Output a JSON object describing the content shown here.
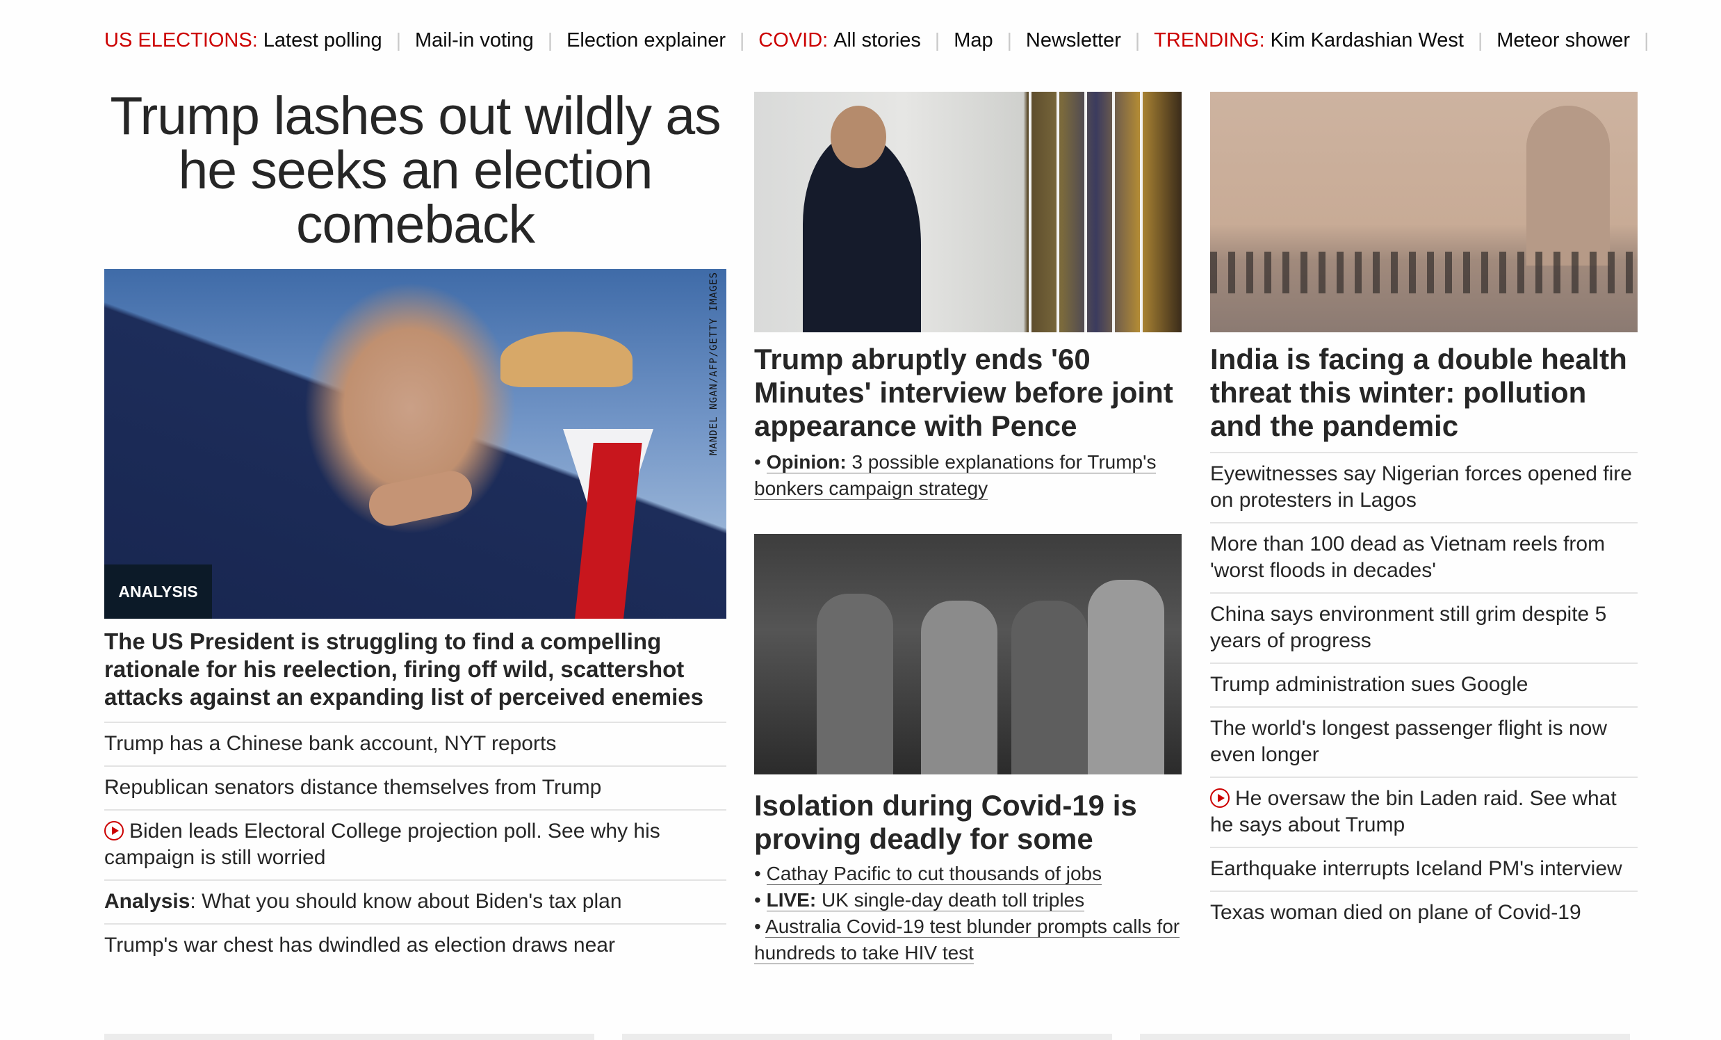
{
  "topnav": [
    {
      "category": "US ELECTIONS:",
      "links": [
        "Latest polling",
        "Mail-in voting",
        "Election explainer"
      ]
    },
    {
      "category": "COVID:",
      "links": [
        "All stories",
        "Map",
        "Newsletter"
      ]
    },
    {
      "category": "TRENDING:",
      "links": [
        "Kim Kardashian West",
        "Meteor shower"
      ]
    }
  ],
  "colors": {
    "accent": "#cc0000",
    "text": "#262626",
    "badge_bg": "#0c1a28"
  },
  "lead": {
    "title": "Trump lashes out wildly as he seeks an election comeback",
    "image_credit": "MANDEL NGAN/AFP/GETTY IMAGES",
    "badge": "ANALYSIS",
    "dek": "The US President is struggling to find a compelling rationale for his reelection, firing off wild, scattershot attacks against an expanding list of perceived enemies",
    "items": [
      {
        "text": "Trump has a Chinese bank account, NYT reports"
      },
      {
        "text": "Republican senators distance themselves from Trump"
      },
      {
        "text": "Biden leads Electoral College projection poll. See why his campaign is still worried",
        "icon": "play-icon"
      },
      {
        "prefix": "Analysis",
        "text": ": What you should know about Biden's tax plan"
      },
      {
        "text": "Trump's war chest has dwindled as election draws near"
      }
    ]
  },
  "trump_story": {
    "title": "Trump abruptly ends '60 Minutes' interview before joint appearance with Pence",
    "bullets": [
      {
        "prefix": "Opinion:",
        "text": "3 possible explanations for Trump's bonkers campaign strategy"
      }
    ]
  },
  "isolation_story": {
    "title": "Isolation during Covid-19 is proving deadly for some",
    "bullets": [
      {
        "prefix": "",
        "text": "Cathay Pacific to cut thousands of jobs"
      },
      {
        "prefix": "LIVE:",
        "text": "UK single-day death toll triples"
      },
      {
        "prefix": "",
        "text": "Australia Covid-19 test blunder prompts calls for hundreds to take HIV test"
      }
    ]
  },
  "india_story": {
    "title": "India is facing a double health threat this winter: pollution and the pandemic",
    "items": [
      {
        "text": "Eyewitnesses say Nigerian forces opened fire on protesters in Lagos"
      },
      {
        "text": "More than 100 dead as Vietnam reels from 'worst floods in decades'"
      },
      {
        "text": "China says environment still grim despite 5 years of progress"
      },
      {
        "text": "Trump administration sues Google"
      },
      {
        "text": "The world's longest passenger flight is now even longer"
      },
      {
        "text": "He oversaw the bin Laden raid. See what he says about Trump",
        "icon": "play-icon"
      },
      {
        "text": "Earthquake interrupts Iceland PM's interview"
      },
      {
        "text": "Texas woman died on plane of Covid-19"
      }
    ]
  }
}
